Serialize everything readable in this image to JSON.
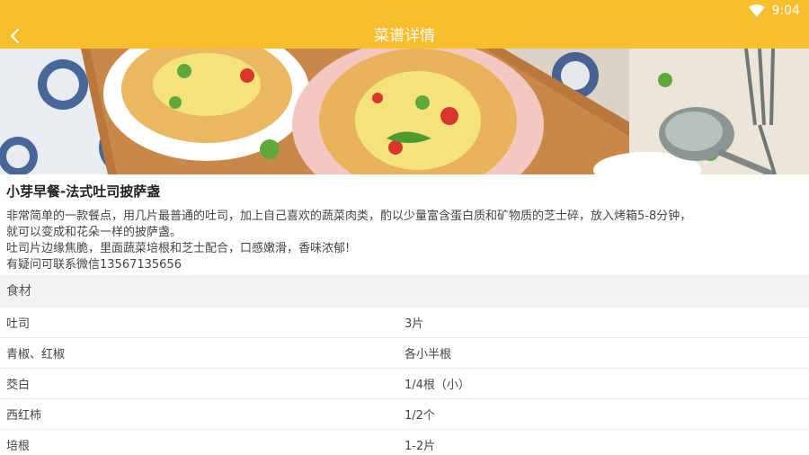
{
  "status": {
    "time": "9:04",
    "wifi_icon": "wifi-icon"
  },
  "appbar": {
    "title": "菜谱详情",
    "back_icon": "back-arrow-icon"
  },
  "recipe": {
    "title": "小芽早餐-法式吐司披萨盏",
    "description_lines": [
      "非常简单的一款餐点，用几片最普通的吐司，加上自己喜欢的蔬菜肉类，酌以少量富含蛋白质和矿物质的芝士碎，放入烤箱5-8分钟，",
      "就可以变成和花朵一样的披萨盏。",
      "吐司片边缘焦脆，里面蔬菜培根和芝士配合，口感嫩滑，香味浓郁!",
      "有疑问可联系微信13567135656"
    ]
  },
  "ingredients": {
    "header": "食材",
    "items": [
      {
        "name": "吐司",
        "qty": "3片"
      },
      {
        "name": "青椒、红椒",
        "qty": "各小半根"
      },
      {
        "name": "茭白",
        "qty": "1/4根（小）"
      },
      {
        "name": "西红柿",
        "qty": "1/2个"
      },
      {
        "name": "培根",
        "qty": "1-2片"
      }
    ]
  },
  "colors": {
    "accent": "#f8be2e"
  }
}
